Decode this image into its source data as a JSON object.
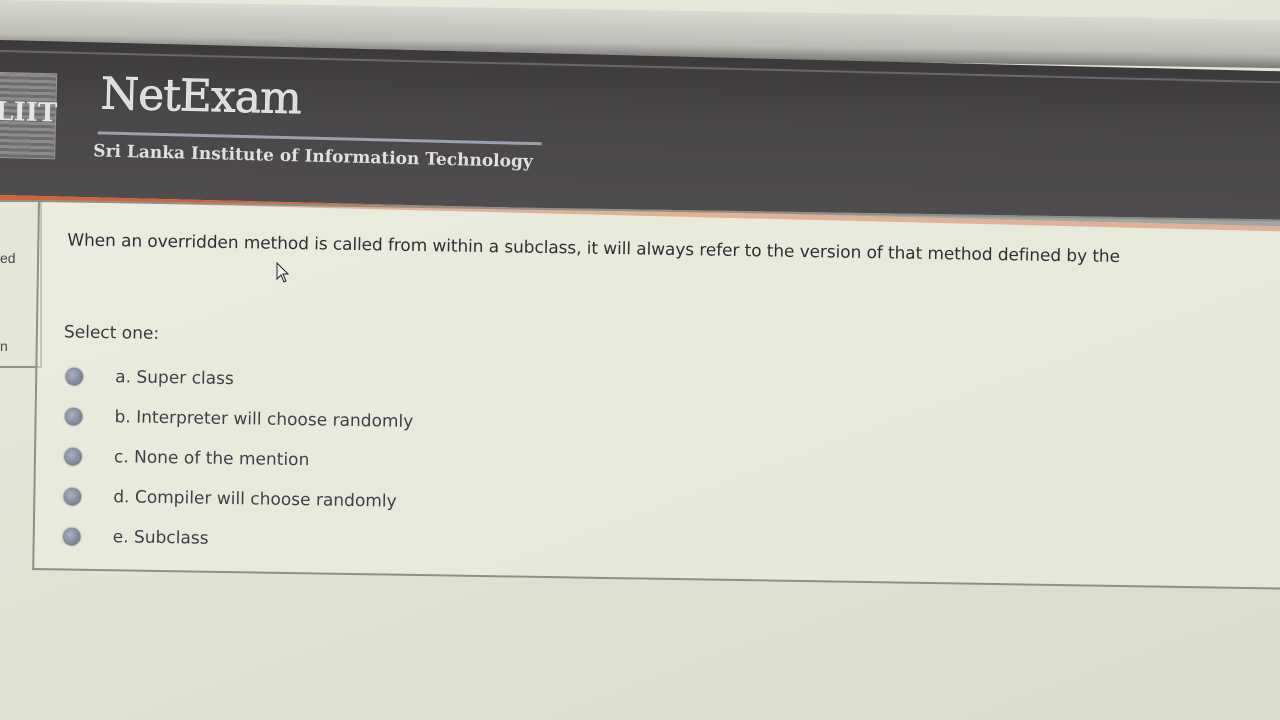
{
  "header": {
    "logo_text": "LIIT",
    "brand": "NetExam",
    "subtitle": "Sri Lanka Institute of Information Technology"
  },
  "left_panel": {
    "text_1": "ed",
    "text_2": "n"
  },
  "question": {
    "text": "When an overridden method is called from within a subclass, it will always refer to the version of that method defined by the",
    "select_label": "Select one:",
    "options": [
      {
        "label": "a. Super class"
      },
      {
        "label": "b. Interpreter will choose randomly"
      },
      {
        "label": "c. None of the mention"
      },
      {
        "label": "d. Compiler will choose randomly"
      },
      {
        "label": "e. Subclass"
      }
    ]
  },
  "icons": {
    "cursor": "mouse-pointer-icon",
    "radio": "radio-button-icon"
  },
  "colors": {
    "header_bg": "#4a4749",
    "accent_bar": "#d2643b",
    "radio": "#7f889b",
    "text": "#2f2f35"
  }
}
